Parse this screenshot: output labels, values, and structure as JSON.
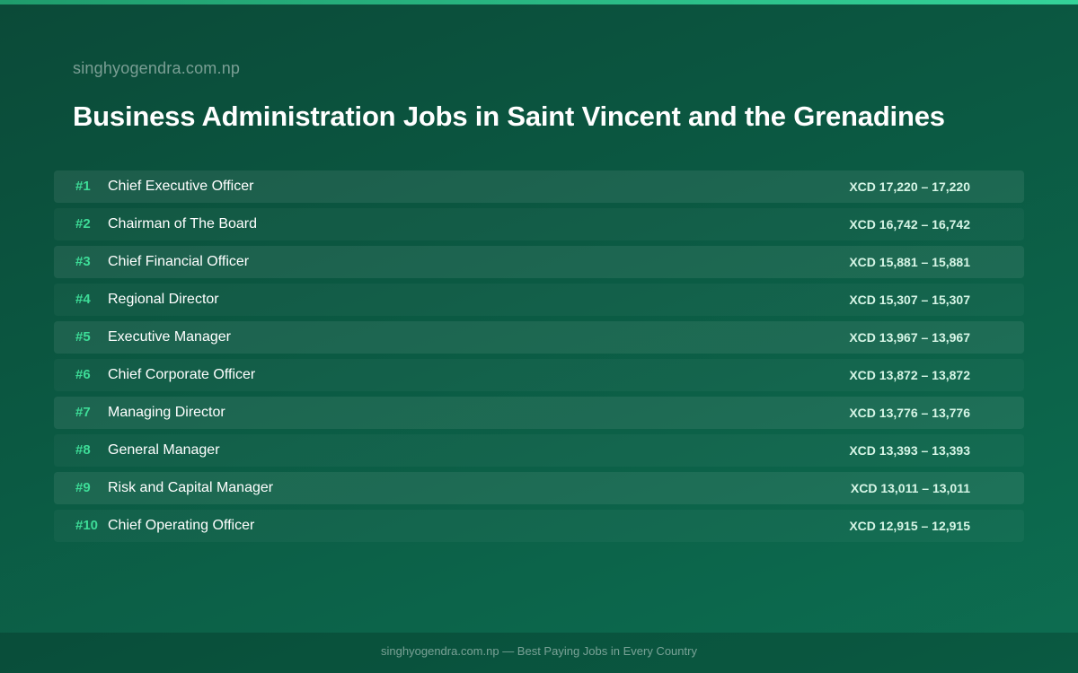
{
  "header": {
    "site_name": "singhyogendra.com.np",
    "title": "Business Administration Jobs in Saint Vincent and the Grenadines"
  },
  "jobs": [
    {
      "rank": "#1",
      "title": "Chief Executive Officer",
      "salary": "XCD 17,220 – 17,220"
    },
    {
      "rank": "#2",
      "title": "Chairman of The Board",
      "salary": "XCD 16,742 – 16,742"
    },
    {
      "rank": "#3",
      "title": "Chief Financial Officer",
      "salary": "XCD 15,881 – 15,881"
    },
    {
      "rank": "#4",
      "title": "Regional Director",
      "salary": "XCD 15,307 – 15,307"
    },
    {
      "rank": "#5",
      "title": "Executive Manager",
      "salary": "XCD 13,967 – 13,967"
    },
    {
      "rank": "#6",
      "title": "Chief Corporate Officer",
      "salary": "XCD 13,872 – 13,872"
    },
    {
      "rank": "#7",
      "title": "Managing Director",
      "salary": "XCD 13,776 – 13,776"
    },
    {
      "rank": "#8",
      "title": "General Manager",
      "salary": "XCD 13,393 – 13,393"
    },
    {
      "rank": "#9",
      "title": "Risk and Capital Manager",
      "salary": "XCD 13,011 – 13,011"
    },
    {
      "rank": "#10",
      "title": "Chief Operating Officer",
      "salary": "XCD 12,915 – 12,915"
    }
  ],
  "footer": {
    "text": "singhyogendra.com.np — Best Paying Jobs in Every Country"
  },
  "colors": {
    "background": "#0b5a43",
    "accent": "#34d399",
    "rank": "#3ddc97",
    "salary": "#d6f5e6"
  }
}
